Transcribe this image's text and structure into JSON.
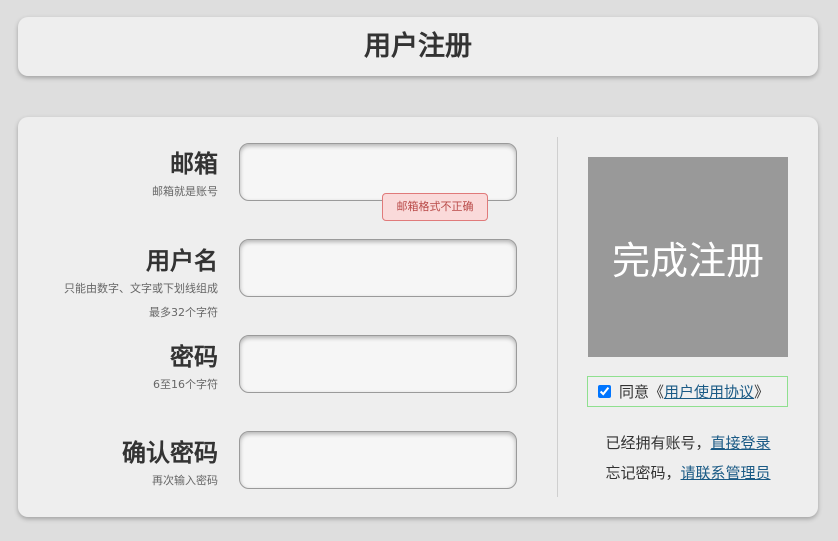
{
  "header": {
    "title": "用户注册"
  },
  "form": {
    "fields": [
      {
        "label": "邮箱",
        "hints": [
          "邮箱就是账号"
        ],
        "value": "",
        "error": "邮箱格式不正确"
      },
      {
        "label": "用户名",
        "hints": [
          "只能由数字、文字或下划线组成",
          "最多32个字符"
        ],
        "value": ""
      },
      {
        "label": "密码",
        "hints": [
          "6至16个字符"
        ],
        "value": ""
      },
      {
        "label": "确认密码",
        "hints": [
          "再次输入密码"
        ],
        "value": ""
      }
    ]
  },
  "side": {
    "submit_label": "完成注册",
    "agree": {
      "checked": true,
      "prefix": "同意《",
      "link": "用户使用协议",
      "suffix": "》"
    },
    "login_prefix": "已经拥有账号，",
    "login_link": "直接登录",
    "forgot_prefix": "忘记密码，",
    "forgot_link": "请联系管理员"
  },
  "colors": {
    "page_bg": "#dedede",
    "panel_bg": "#eeeeee",
    "submit_bg": "#999999",
    "error_bg": "#fadada",
    "error_text": "#b94a48",
    "agree_border": "#8fe08f",
    "link": "#1a5a85"
  },
  "icons": {
    "agree_checkbox": "checkbox-checked"
  }
}
